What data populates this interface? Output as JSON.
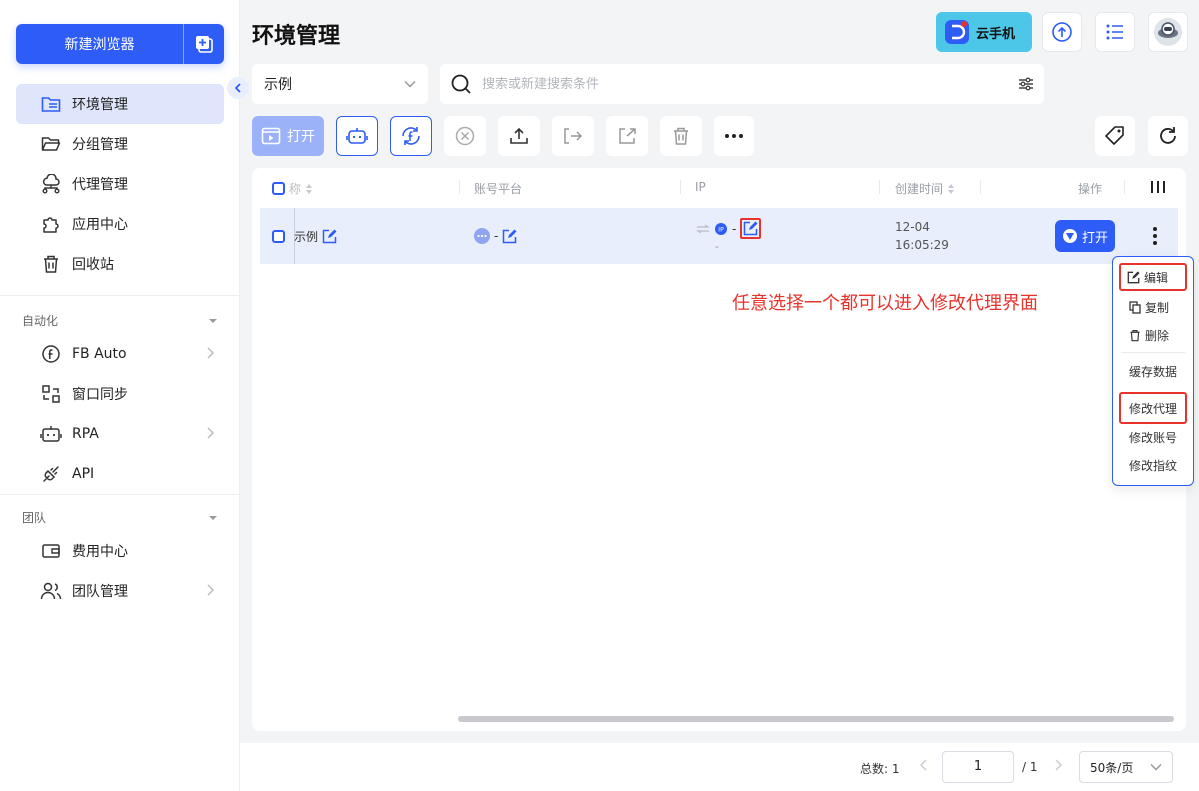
{
  "sidebar": {
    "new_browser": "新建浏览器",
    "items": [
      {
        "label": "环境管理"
      },
      {
        "label": "分组管理"
      },
      {
        "label": "代理管理"
      },
      {
        "label": "应用中心"
      },
      {
        "label": "回收站"
      }
    ],
    "automation": {
      "title": "自动化",
      "items": [
        {
          "label": "FB Auto"
        },
        {
          "label": "窗口同步"
        },
        {
          "label": "RPA"
        },
        {
          "label": "API"
        }
      ]
    },
    "team": {
      "title": "团队",
      "items": [
        {
          "label": "费用中心"
        },
        {
          "label": "团队管理"
        }
      ]
    }
  },
  "header": {
    "title": "环境管理",
    "cloud_phone": "云手机"
  },
  "filter": {
    "select_value": "示例",
    "search_placeholder": "搜索或新建搜索条件"
  },
  "toolbar": {
    "open_label": "打开"
  },
  "table": {
    "columns": {
      "name": "称",
      "platform": "账号平台",
      "ip": "IP",
      "created": "创建时间",
      "actions": "操作"
    },
    "rows": [
      {
        "name": "示例",
        "platform": "-",
        "ip": "-",
        "ip_sub": "-",
        "date": "12-04",
        "time": "16:05:29",
        "open": "打开"
      }
    ]
  },
  "annotation": "任意选择一个都可以进入修改代理界面",
  "context_menu": {
    "edit": "编辑",
    "copy": "复制",
    "delete": "删除",
    "cache": "缓存数据",
    "proxy": "修改代理",
    "account": "修改账号",
    "fingerprint": "修改指纹"
  },
  "footer": {
    "total": "总数: 1",
    "page": "1",
    "of": "/ 1",
    "page_size": "50条/页"
  },
  "colors": {
    "primary": "#2d5cf6",
    "annotation_red": "#e8322c",
    "active_nav_bg": "#dfe6fb",
    "cloud_phone_bg": "#4dc7e8"
  }
}
